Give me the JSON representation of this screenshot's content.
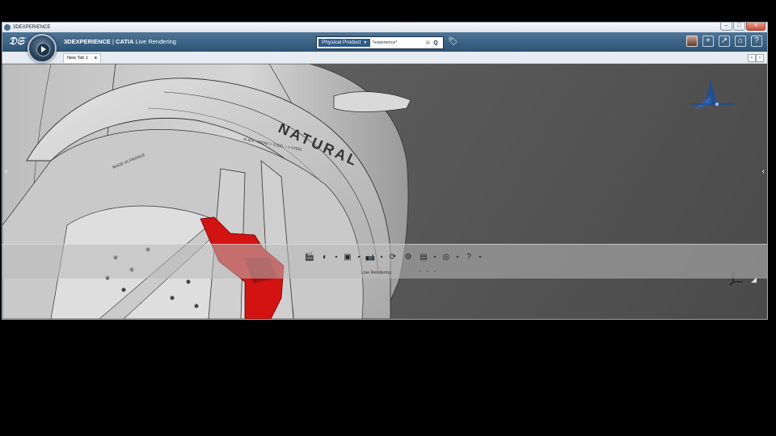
{
  "os_window": {
    "title": "3DEXPERIENCE",
    "controls": {
      "minimize": "–",
      "maximize": "□",
      "close": "x"
    }
  },
  "header": {
    "logo_glyph": "𝔇𝔖",
    "brand": "3DEXPERIENCE",
    "separator": " | ",
    "app": "CATIA",
    "module": " Live Rendering",
    "search": {
      "scope": "Physical Product",
      "scope_arrow": "▼",
      "value": "*experience*",
      "clear_glyph": "⊗",
      "go_glyph": "Q"
    },
    "tag_glyph": "🏷",
    "right_icons": {
      "avatar": "",
      "add": "+",
      "share": "↗",
      "home": "⌂",
      "help": "?"
    }
  },
  "tabs": {
    "items": [
      {
        "label": "New Tab 1",
        "close": "x"
      }
    ],
    "nav_left": "‹",
    "nav_right": "›"
  },
  "viewport": {
    "left_arrow": "›",
    "right_arrow": "‹",
    "tire_text": {
      "brand": "NATURAL",
      "made_in": "MADE  IN  FRANCE",
      "plies": "PLIES : TREAD 1 STEEL + 2 STEEL"
    },
    "resize_glyph": "◢"
  },
  "action_bar": {
    "label": "Live Rendering",
    "dots": "• • •",
    "tools": {
      "clapperboard": "🎬",
      "material": "◐",
      "image": "▣",
      "camera": "📷",
      "rotate": "⟳",
      "settings": "⚙",
      "document": "▤",
      "environment": "◎",
      "help": "?",
      "more": "▾"
    }
  },
  "colors": {
    "header_blue": "#2c5274",
    "search_scope": "#2f5b86",
    "caliper_red": "#d31212",
    "viewport_gray": "#5a5a5a",
    "gizmo_blue": "#1e4d9a"
  }
}
